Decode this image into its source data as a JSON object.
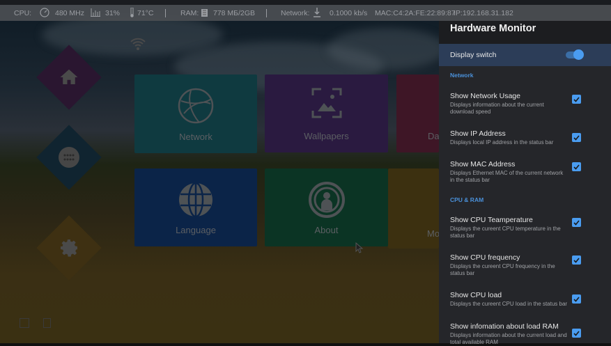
{
  "status_bar": {
    "cpu_label": "CPU:",
    "cpu_freq": "480 MHz",
    "cpu_load": "31%",
    "cpu_temp": "71°C",
    "ram_label": "RAM:",
    "ram_value": "778 МБ/2GB",
    "network_label": "Network:",
    "network_speed": "0.1000 kb/s",
    "mac": "MAC:C4:2A:FE:22:89:87",
    "ip": "IP:192.168.31.182"
  },
  "launcher": {
    "tiles": [
      {
        "label": "Network",
        "color": "#0f3a40"
      },
      {
        "label": "Wallpapers",
        "color": "#2a1a40"
      },
      {
        "label": "Da",
        "color": "#3e1626"
      },
      {
        "label": "Language",
        "color": "#0b2448"
      },
      {
        "label": "About",
        "color": "#0b3424"
      },
      {
        "label": "Mo",
        "color": "#3c3010"
      }
    ]
  },
  "panel": {
    "title": "Hardware Monitor",
    "display_switch": {
      "label": "Display switch",
      "on": true
    },
    "sections": [
      {
        "title": "Network",
        "items": [
          {
            "title": "Show Network Usage",
            "desc": "Displays information about the current download speed",
            "checked": true
          },
          {
            "title": "Show IP Address",
            "desc": "Displays local IP address in the status bar",
            "checked": true
          },
          {
            "title": "Show MAC Address",
            "desc": "Displays Ethernet MAC of the current network in the status bar",
            "checked": true
          }
        ]
      },
      {
        "title": "CPU & RAM",
        "items": [
          {
            "title": "Show CPU Teamperature",
            "desc": "Displays the cureent CPU temperature in the status bar",
            "checked": true
          },
          {
            "title": "Show CPU frequency",
            "desc": "Displays the cureent CPU frequency in the status bar",
            "checked": true
          },
          {
            "title": "Show CPU load",
            "desc": "Displays the cureent CPU load in the status bar",
            "checked": true
          },
          {
            "title": "Show infomation about load RAM",
            "desc": "Displays information about the current load and total available RAM",
            "checked": true
          }
        ]
      }
    ]
  }
}
